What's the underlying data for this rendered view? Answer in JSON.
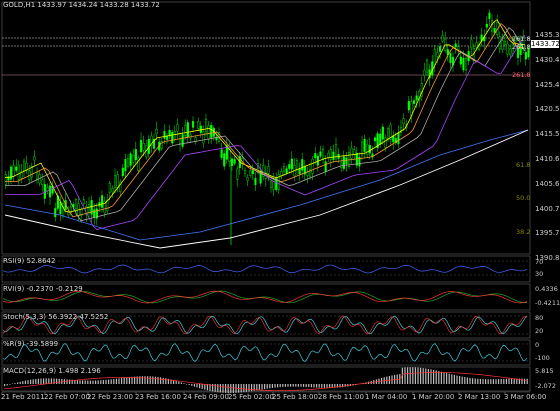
{
  "header": {
    "symbol_line": "GOLD,H1  1433.97 1434.24 1433.28 1433.72"
  },
  "price_axis": [
    "1435.35",
    "1430.40",
    "1425.45",
    "1420.50",
    "1415.55",
    "1410.60",
    "1405.65",
    "1400.70",
    "1395.75",
    "1390.80"
  ],
  "current_price": "1433.72",
  "fib_labels": [
    {
      "text": "261.8",
      "color": "#dddddd"
    },
    {
      "text": "261.8",
      "color": "#dddddd"
    },
    {
      "text": "261.8",
      "color": "#ff6666"
    },
    {
      "text": "61.8",
      "color": "#888800"
    },
    {
      "text": "50.0",
      "color": "#888800"
    },
    {
      "text": "38.2",
      "color": "#888800"
    }
  ],
  "x_axis": [
    "21 Feb 2011",
    "22 Feb 07:00",
    "22 Feb 23:00",
    "23 Feb 16:00",
    "24 Feb 09:00",
    "25 Feb 02:00",
    "25 Feb 18:00",
    "28 Feb 11:00",
    "1 Mar 04:00",
    "1 Mar 20:00",
    "2 Mar 13:00",
    "3 Mar 06:00"
  ],
  "subpanels": {
    "rsi": {
      "label": "RSI(9) 52.8642",
      "axis": [
        "70",
        "30"
      ]
    },
    "rvi": {
      "label": "RVI(9) -0.2370 -0.2129",
      "axis": [
        "0.4336",
        "-0.4211"
      ]
    },
    "stoch": {
      "label": "Stoch(5,3,3) 56.3922 47.5252",
      "axis": [
        "80",
        "20"
      ]
    },
    "wpr": {
      "label": "%R(9) -39.5899",
      "axis": [
        "0",
        "-100"
      ]
    },
    "macd": {
      "label": "MACD(12,26,9) 1.498 2.196",
      "axis": [
        "5.815",
        "-2.072"
      ]
    }
  },
  "colors": {
    "candle_up": "#00ff00",
    "candle_down": "#000000",
    "ma_fast": "#ffff00",
    "ma_mid": "#ff9933",
    "ma_slow": "#aaaaaa",
    "ma_purple": "#aa44ff",
    "ma_white": "#ffffff",
    "ma_blue": "#4477ff",
    "rsi_line": "#4466ff",
    "rvi_main": "#22aa22",
    "rvi_signal": "#ff3333",
    "stoch_main": "#44ccdd",
    "stoch_signal": "#ff3333",
    "wpr_line": "#44ccdd",
    "macd_hist": "#bbbbbb",
    "macd_signal": "#ff3333"
  }
}
